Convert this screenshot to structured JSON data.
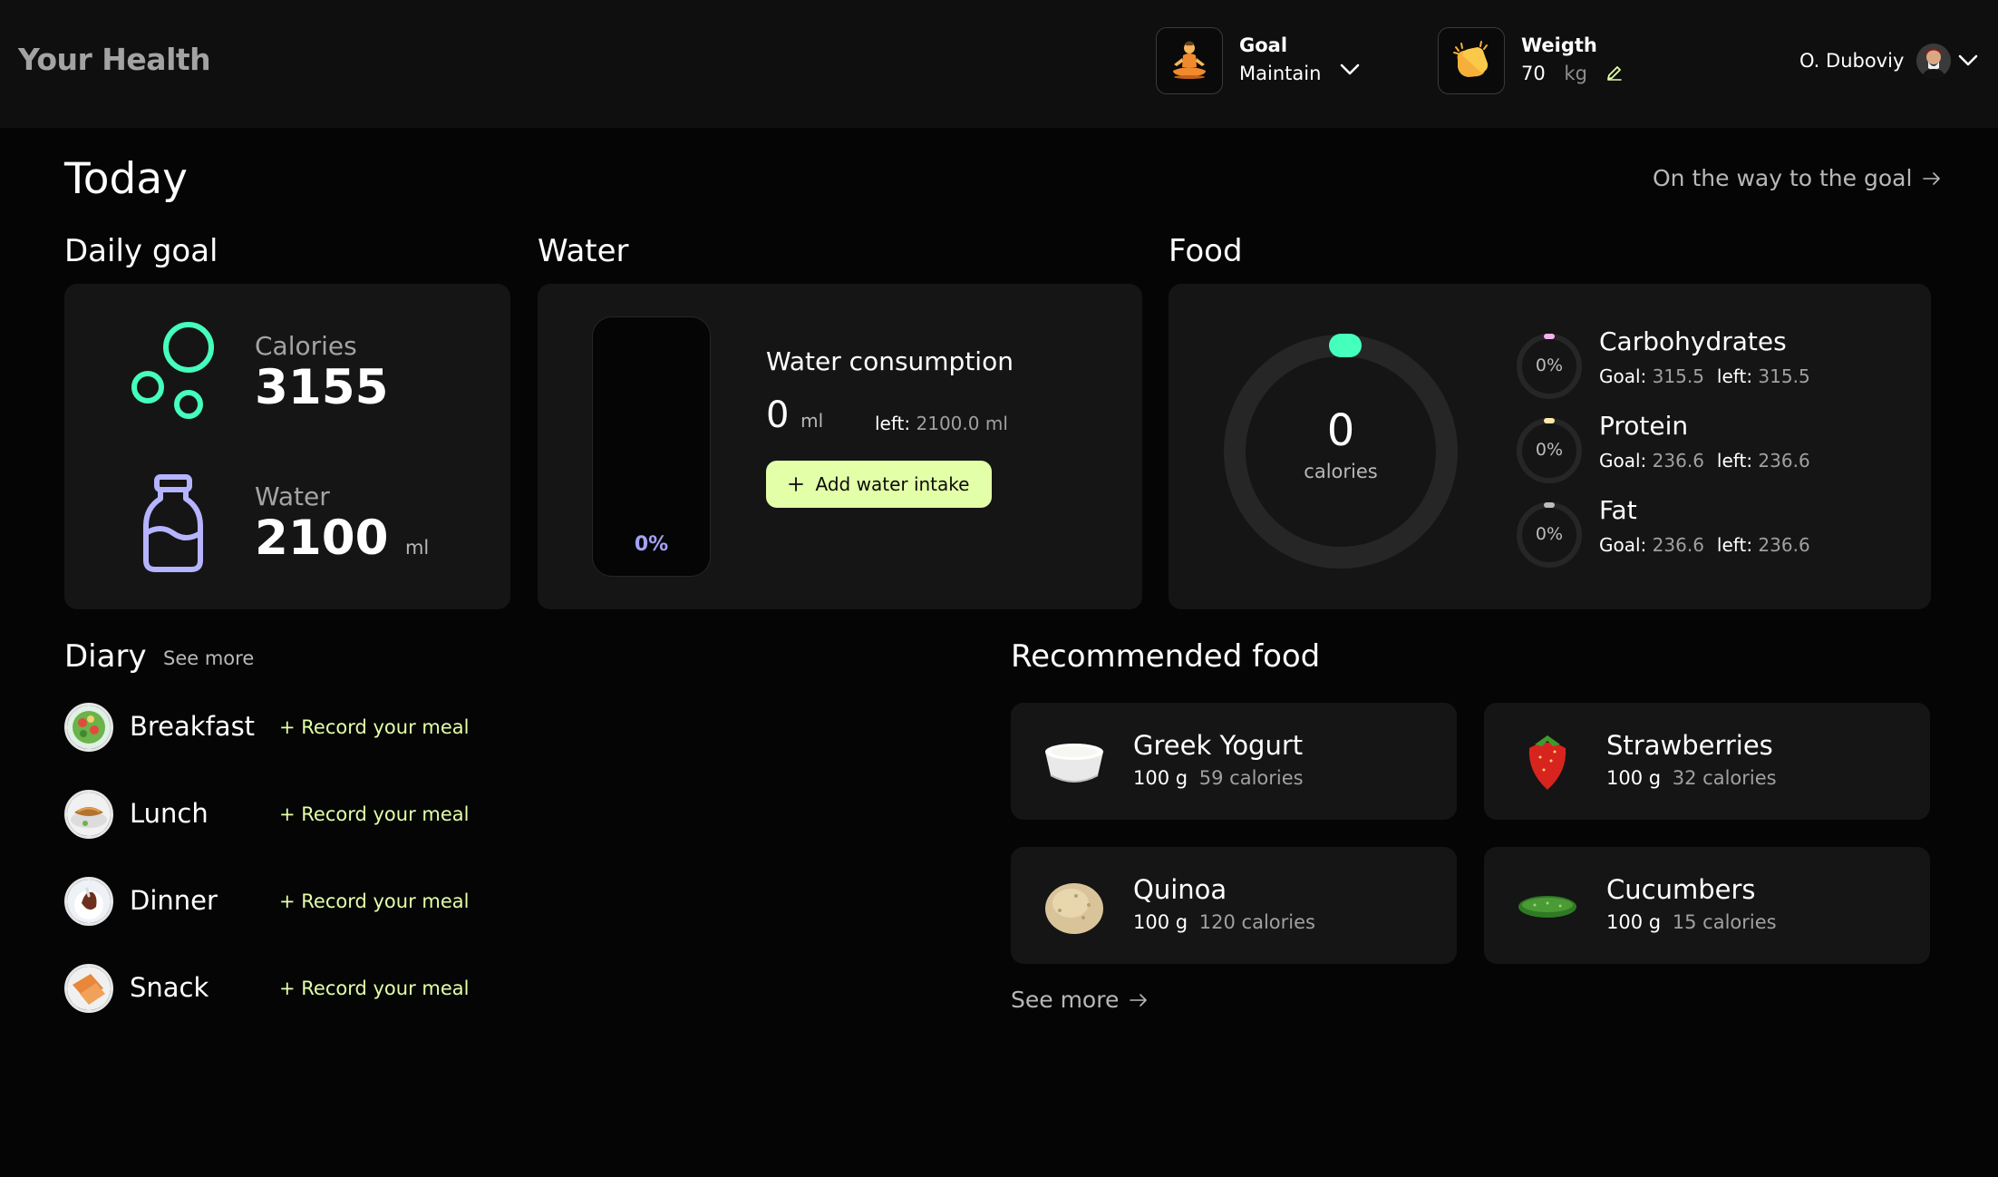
{
  "header": {
    "brand": "Your Health",
    "goal": {
      "label": "Goal",
      "value": "Maintain",
      "icon": "meditation-emoji-icon"
    },
    "weight": {
      "label": "Weigth",
      "value": "70",
      "unit": "kg",
      "icon": "clapping-hands-emoji-icon"
    },
    "user": {
      "name": "O. Duboviy"
    }
  },
  "page": {
    "title": "Today",
    "goal_link": "On the way to the goal"
  },
  "daily_goal": {
    "title": "Daily goal",
    "calories": {
      "label": "Calories",
      "value": "3155"
    },
    "water": {
      "label": "Water",
      "value": "2100",
      "unit": "ml"
    }
  },
  "water": {
    "title": "Water",
    "heading": "Water consumption",
    "consumed": "0",
    "consumed_unit": "ml",
    "left_label": "left:",
    "left_value": "2100.0 ml",
    "percent": "0%",
    "fill_fraction": 0,
    "add_button": "Add water intake"
  },
  "food": {
    "title": "Food",
    "calories_value": "0",
    "calories_label": "calories",
    "progress_fraction": 0,
    "macros": [
      {
        "name": "Carbohydrates",
        "percent": "0%",
        "goal_label": "Goal:",
        "goal": "315.5",
        "left_label": "left:",
        "left": "315.5",
        "color": "#f4b3f0"
      },
      {
        "name": "Protein",
        "percent": "0%",
        "goal_label": "Goal:",
        "goal": "236.6",
        "left_label": "left:",
        "left": "236.6",
        "color": "#ffe9a8"
      },
      {
        "name": "Fat",
        "percent": "0%",
        "goal_label": "Goal:",
        "goal": "236.6",
        "left_label": "left:",
        "left": "236.6",
        "color": "#bdbdbd"
      }
    ]
  },
  "diary": {
    "title": "Diary",
    "see_more": "See more",
    "record_label": "+ Record your meal",
    "meals": [
      {
        "name": "Breakfast"
      },
      {
        "name": "Lunch"
      },
      {
        "name": "Dinner"
      },
      {
        "name": "Snack"
      }
    ]
  },
  "recommended": {
    "title": "Recommended food",
    "see_more": "See more",
    "items": [
      {
        "name": "Greek Yogurt",
        "amount": "100 g",
        "calories": "59 calories"
      },
      {
        "name": "Strawberries",
        "amount": "100 g",
        "calories": "32 calories"
      },
      {
        "name": "Quinoa",
        "amount": "100 g",
        "calories": "120 calories"
      },
      {
        "name": "Cucumbers",
        "amount": "100 g",
        "calories": "15 calories"
      }
    ]
  },
  "colors": {
    "accent_green": "#45ffbc",
    "accent_lime": "#e3ffa8",
    "accent_purple": "#b6b4ff",
    "background": "#050505",
    "card": "#151515"
  }
}
